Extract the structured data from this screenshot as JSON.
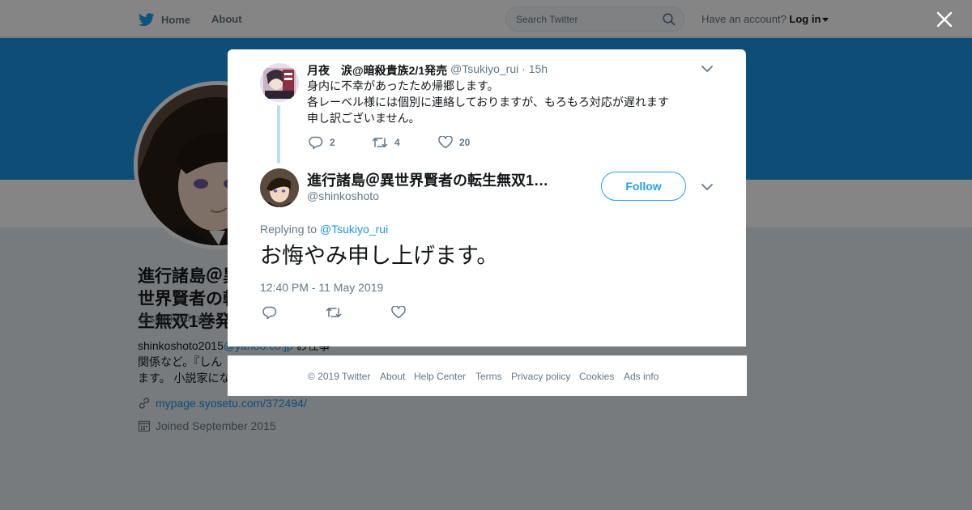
{
  "nav": {
    "home_label": "Home",
    "about_label": "About",
    "search_placeholder": "Search Twitter",
    "account_prompt": "Have an account?",
    "login_label": "Log in"
  },
  "profile": {
    "name_partial": "進行諸島＠異世界賢者の転生無双1巻発",
    "handle": "@shinkoshoto",
    "bio_line1": "shinkoshoto2015",
    "bio_link_fragment": "@yahoo.co.jp",
    "bio_suffix": "お仕事",
    "bio_line2": "関係など。『しん",
    "bio_line3": "ます。 小説家にな",
    "website": "mypage.syosetu.com/372494/",
    "joined": "Joined September 2015"
  },
  "parent_tweet": {
    "author_name": "月夜　涙@暗殺貴族2/1発売",
    "author_handle": "@Tsukiyo_rui",
    "time_ago": "15h",
    "text_lines": [
      "身内に不幸があったため帰郷します。",
      "各レーベル様には個別に連絡しておりますが、もろもろ対応が遅れます",
      "申し訳ございません。"
    ],
    "reply_count": "2",
    "retweet_count": "4",
    "like_count": "20"
  },
  "main_tweet": {
    "author_name": "進行諸島＠異世界賢者の転生無双1…",
    "author_handle": "@shinkoshoto",
    "follow_label": "Follow",
    "replying_prefix": "Replying to",
    "replying_handle": "@Tsukiyo_rui",
    "text": "お悔やみ申し上げます。",
    "timestamp": "12:40 PM - 11 May 2019"
  },
  "footer": {
    "items": [
      "© 2019 Twitter",
      "About",
      "Help Center",
      "Terms",
      "Privacy policy",
      "Cookies",
      "Ads info"
    ]
  },
  "colors": {
    "twitter_blue": "#1da1f2",
    "banner": "#1b95e0",
    "thread_line": "#bbddf5"
  }
}
